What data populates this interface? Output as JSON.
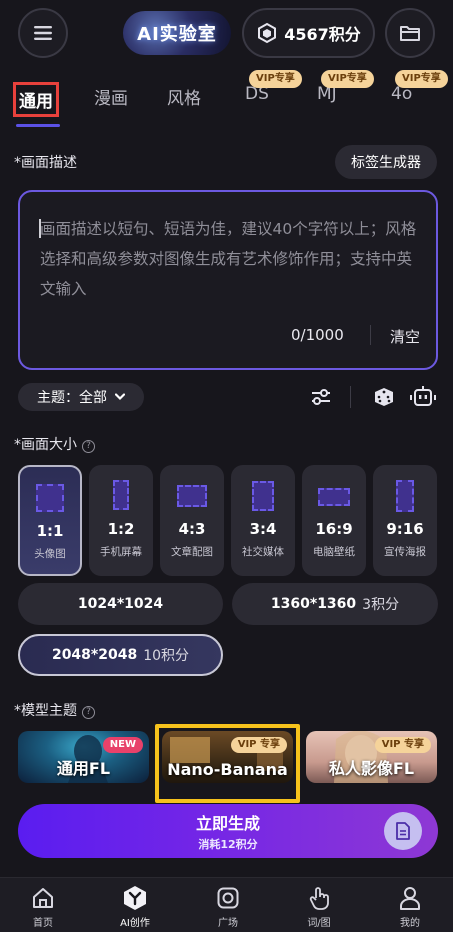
{
  "header": {
    "title": "AI实验室",
    "points": "4567积分"
  },
  "tabs": [
    {
      "label": "通用",
      "active": true,
      "badge": ""
    },
    {
      "label": "漫画",
      "active": false,
      "badge": ""
    },
    {
      "label": "风格",
      "active": false,
      "badge": ""
    },
    {
      "label": "DS",
      "active": false,
      "badge": "VIP专享"
    },
    {
      "label": "MJ",
      "active": false,
      "badge": "VIP专享"
    },
    {
      "label": "4o",
      "active": false,
      "badge": "VIP专享"
    }
  ],
  "prompt": {
    "section_label": "*画面描述",
    "tag_generator": "标签生成器",
    "placeholder": "画面描述以短句、短语为佳，建议40个字符以上；风格选择和高级参数对图像生成有艺术修饰作用；支持中英文输入",
    "char_count": "0/1000",
    "clear": "清空"
  },
  "theme": {
    "label": "主题：全部"
  },
  "size_section": {
    "label": "*画面大小",
    "ratios": [
      {
        "value": "1:1",
        "label": "头像图",
        "selected": true
      },
      {
        "value": "1:2",
        "label": "手机屏幕",
        "selected": false
      },
      {
        "value": "4:3",
        "label": "文章配图",
        "selected": false
      },
      {
        "value": "3:4",
        "label": "社交媒体",
        "selected": false
      },
      {
        "value": "16:9",
        "label": "电脑壁纸",
        "selected": false
      },
      {
        "value": "9:16",
        "label": "宣传海报",
        "selected": false
      }
    ],
    "resolutions": [
      {
        "size": "1024*1024",
        "cost": "",
        "selected": false
      },
      {
        "size": "1360*1360",
        "cost": "3积分",
        "selected": false
      },
      {
        "size": "2048*2048",
        "cost": "10积分",
        "selected": true
      }
    ]
  },
  "model_section": {
    "label": "*模型主题",
    "models": [
      {
        "name": "通用FL",
        "badge": "NEW"
      },
      {
        "name": "Nano-Banana",
        "badge": "VIP 专享"
      },
      {
        "name": "私人影像FL",
        "badge": "VIP 专享"
      }
    ]
  },
  "generate": {
    "title": "立即生成",
    "cost": "消耗12积分"
  },
  "nav": [
    {
      "label": "首页",
      "active": false
    },
    {
      "label": "AI创作",
      "active": true
    },
    {
      "label": "广场",
      "active": false
    },
    {
      "label": "词/图",
      "active": false
    },
    {
      "label": "我的",
      "active": false
    }
  ],
  "colors": {
    "accent": "#6c59e0",
    "highlight": "#f6c21c",
    "vip_badge": "#f5d39a",
    "active_tab_frame": "#e8413c"
  }
}
